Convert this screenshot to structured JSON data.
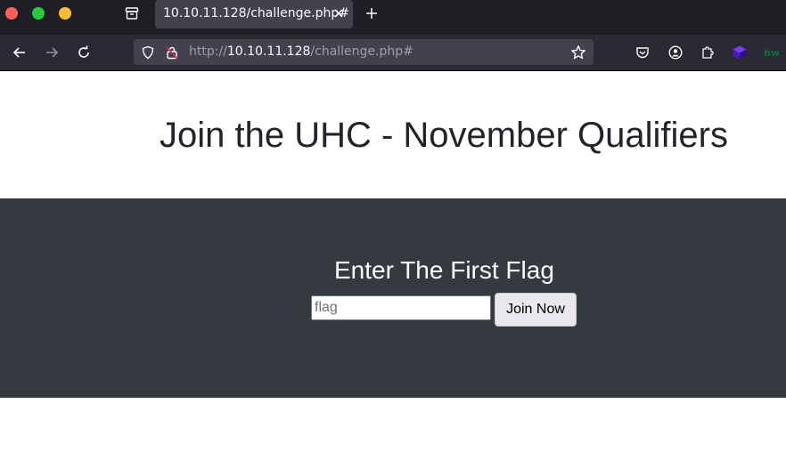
{
  "browser": {
    "tab_title": "10.10.11.128/challenge.php#",
    "url_prefix": "http://",
    "url_host": "10.10.11.128",
    "url_path": "/challenge.php#"
  },
  "icons": {
    "back": "arrow-left-icon",
    "forward": "arrow-right-icon",
    "reload": "reload-icon",
    "tracking": "shield-icon",
    "insecure": "insecure-lock-icon",
    "bookmark": "star-icon",
    "pocket": "pocket-icon",
    "account": "account-icon",
    "extensions": "puzzle-icon",
    "ext1": "layers-extension-icon",
    "ext2": "bitwarden-extension-icon"
  },
  "page": {
    "title": "Join the UHC - November Qualifiers",
    "form_heading": "Enter The First Flag",
    "input_placeholder": "flag",
    "input_value": "",
    "button_label": "Join Now"
  },
  "colors": {
    "tabbar_bg": "#1f1e25",
    "navbar_bg": "#2b2a33",
    "band_bg": "#343a40",
    "title_text": "#212529"
  }
}
